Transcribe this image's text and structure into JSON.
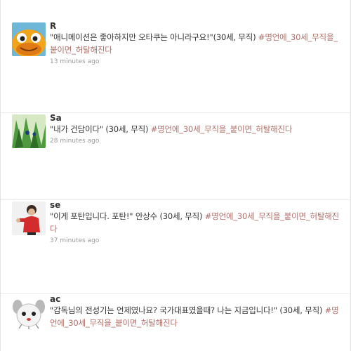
{
  "tweets": [
    {
      "user": "R",
      "quote": "\"애니메이션은 좋아하지만 오타쿠는 아니라구요!\"",
      "meta": "(30세, 무직)",
      "hashtag": "#명언에_30세_무직을_붙이면_허탈해진다",
      "time": "13 minutes ago",
      "avatar_icon": "orange-cartoon-creature-icon"
    },
    {
      "user": "Sa",
      "quote": "\"내가 건담이다\"",
      "meta": "(30세, 무직)",
      "hashtag": "#명언에_30세_무직을_붙이면_허탈해진다",
      "time": "28 minutes ago",
      "avatar_icon": "green-anime-character-icon"
    },
    {
      "user": "se",
      "quote": "\"이게 포탄입니다. 포탄!\" 안상수",
      "meta": "(30세, 무직)",
      "hashtag": "#명언에_30세_무직을_붙이면_허탈해진다",
      "time": "37 minutes ago",
      "avatar_icon": "person-red-shirt-icon"
    },
    {
      "user": "ac",
      "quote": "\"감독님의 전성기는 언제였나요? 국가대표였을때? 나는 지금입니다!\"",
      "meta": "(30세, 무직)",
      "hashtag": "#명언에_30세_무직을_붙이면_허탈해진다",
      "time": "",
      "avatar_icon": "white-cartoon-animal-icon"
    }
  ]
}
